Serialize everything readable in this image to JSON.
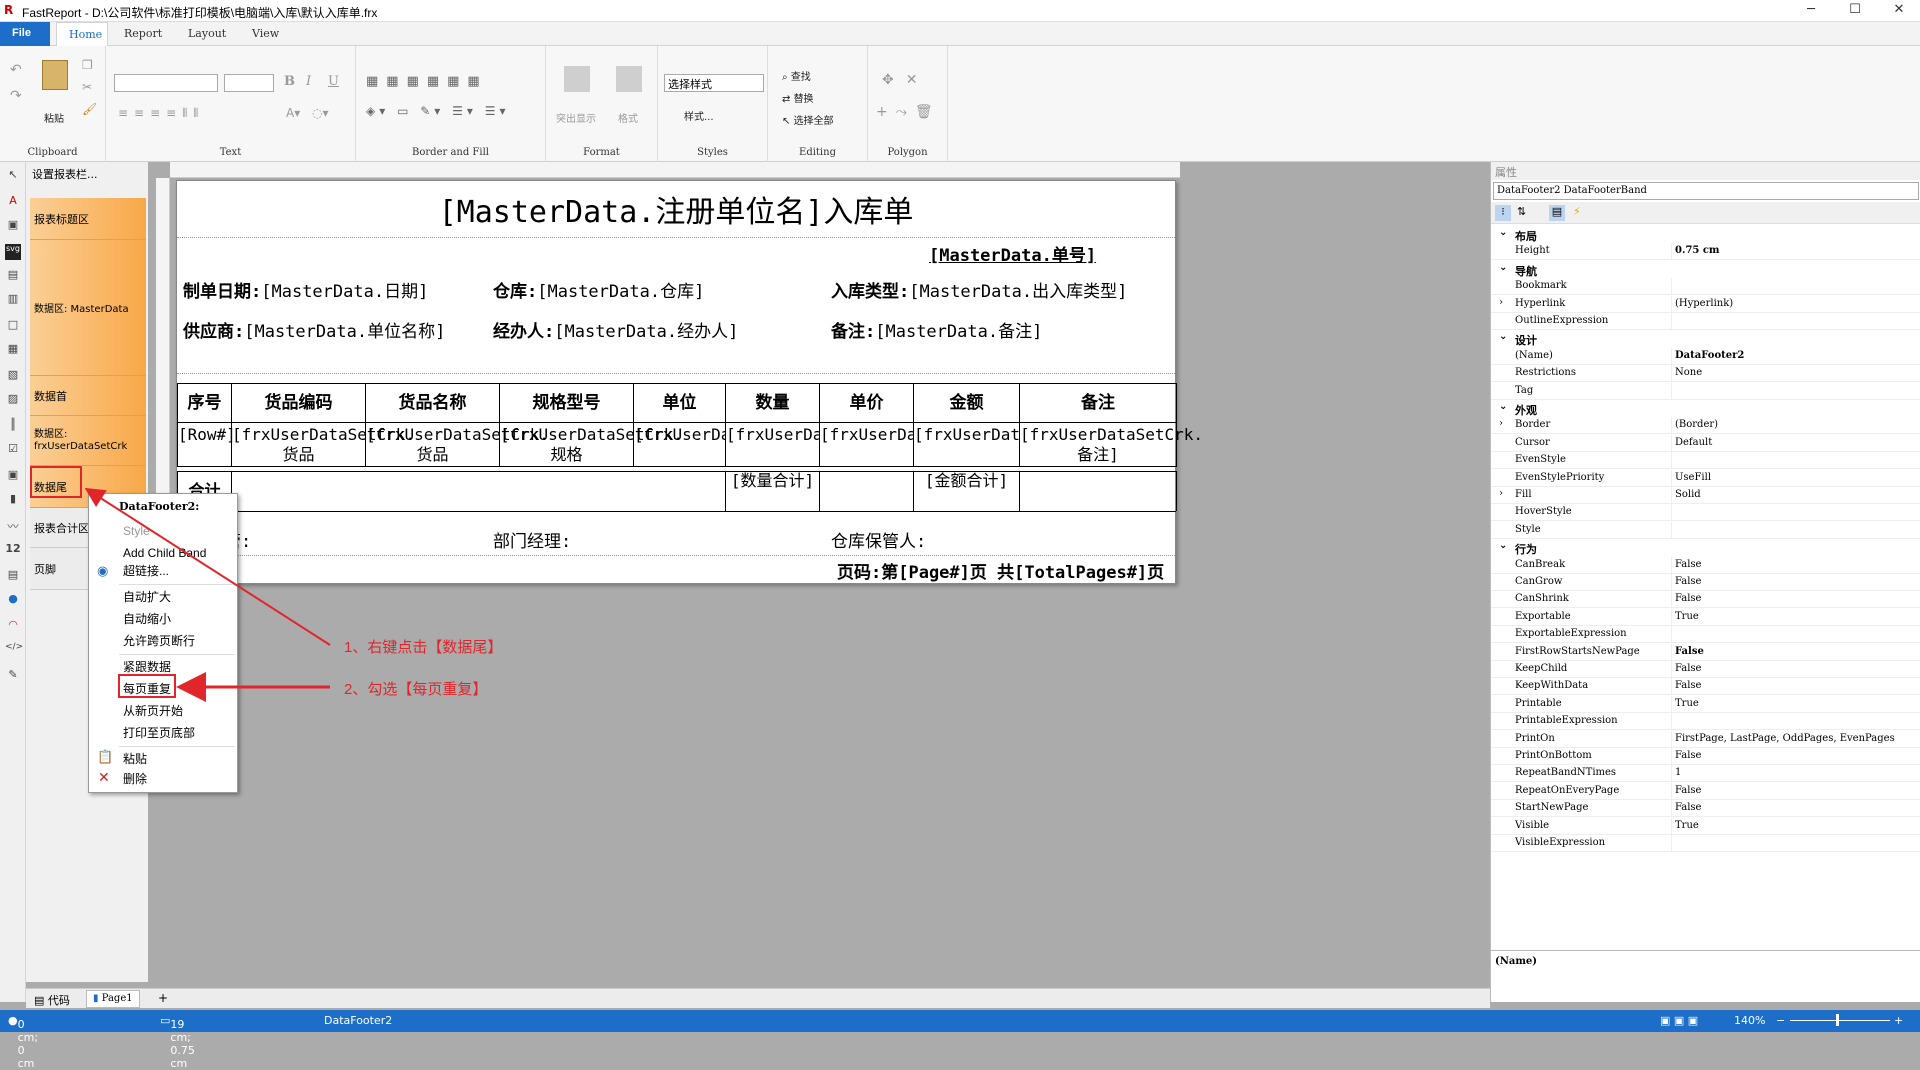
{
  "window": {
    "title": "FastReport - D:\\公司软件\\标准打印模板\\电脑端\\入库\\默认入库单.frx",
    "minimize": "─",
    "maximize": "☐",
    "close": "✕"
  },
  "tabs": [
    {
      "label": "File"
    },
    {
      "label": "Home"
    },
    {
      "label": "Report"
    },
    {
      "label": "Layout"
    },
    {
      "label": "View"
    }
  ],
  "ribbon": {
    "clipboard": {
      "label": "Clipboard",
      "paste": "粘贴"
    },
    "text": {
      "label": "Text",
      "bold": "B",
      "italic": "I",
      "underline": "U"
    },
    "border": {
      "label": "Border and Fill"
    },
    "format": {
      "label": "Format",
      "highlight": "突出显示",
      "format_btn": "格式"
    },
    "styles": {
      "label": "Styles",
      "select": "选择样式",
      "style_btn": "样式..."
    },
    "editing": {
      "label": "Editing",
      "find": "查找",
      "replace": "替换",
      "select_all": "选择全部"
    },
    "polygon": {
      "label": "Polygon"
    }
  },
  "bands": {
    "top_setting": "设置报表栏...",
    "items": [
      {
        "label": "报表标题区"
      },
      {
        "label": "数据区: MasterData"
      },
      {
        "label": "数据首"
      },
      {
        "label": "数据区:\nfrxUserDataSetCrk"
      },
      {
        "label": "数据尾"
      },
      {
        "label": "报表合计区"
      },
      {
        "label": "页脚"
      }
    ]
  },
  "report": {
    "title": "[MasterData.注册单位名]入库单",
    "bill_no": "[MasterData.单号]",
    "fields": [
      {
        "label": "制单日期:",
        "value": "[MasterData.日期]"
      },
      {
        "label": "仓库:",
        "value": "[MasterData.仓库]"
      },
      {
        "label": "入库类型:",
        "value": "[MasterData.出入库类型]"
      },
      {
        "label": "供应商:",
        "value": "[MasterData.单位名称]"
      },
      {
        "label": "经办人:",
        "value": "[MasterData.经办人]"
      },
      {
        "label": "备注:",
        "value": "[MasterData.备注]"
      }
    ],
    "headers": [
      "序号",
      "货品编码",
      "货品名称",
      "规格型号",
      "单位",
      "数量",
      "单价",
      "金额",
      "备注"
    ],
    "data_row": [
      "[Row#]",
      "[frxUserDataSetCrk.货品",
      "[frxUserDataSetCrk.货品",
      "[frxUserDataSetCrk.规格",
      "[frxUserDataSetC",
      "[frxUserDataSetC",
      "[frxUserDataSetC",
      "[frxUserDataSetCrk",
      "[frxUserDataSetCrk.备注]"
    ],
    "sum_label": "合计",
    "sum_qty": "[数量合计]",
    "sum_amount": "[金额合计]",
    "footer_manager": "主管:",
    "footer_dept": "部门经理:",
    "footer_keeper": "仓库保管人:",
    "page_no": "页码:第[Page#]页 共[TotalPages#]页"
  },
  "context_menu": {
    "header": "DataFooter2:",
    "items": [
      {
        "label": "Style",
        "disabled": true
      },
      {
        "label": "Add Child Band"
      },
      {
        "label": "超链接..."
      },
      {
        "label": "自动扩大"
      },
      {
        "label": "自动缩小"
      },
      {
        "label": "允许跨页断行"
      },
      {
        "label": "紧跟数据"
      },
      {
        "label": "每页重复"
      },
      {
        "label": "从新页开始"
      },
      {
        "label": "打印至页底部"
      },
      {
        "label": "粘贴"
      },
      {
        "label": "删除"
      }
    ]
  },
  "annotations": {
    "step1": "1、右键点击【数据尾】",
    "step2": "2、勾选【每页重复】"
  },
  "properties": {
    "header": "属性",
    "object": "DataFooter2 DataFooterBand",
    "rows": [
      {
        "cat": "布局"
      },
      {
        "name": "Height",
        "value": "0.75 cm",
        "bold": true
      },
      {
        "cat": "导航"
      },
      {
        "name": "Bookmark",
        "value": ""
      },
      {
        "name": "Hyperlink",
        "value": "(Hyperlink)",
        "exp": true
      },
      {
        "name": "OutlineExpression",
        "value": ""
      },
      {
        "cat": "设计"
      },
      {
        "name": "(Name)",
        "value": "DataFooter2",
        "bold": true
      },
      {
        "name": "Restrictions",
        "value": "None"
      },
      {
        "name": "Tag",
        "value": ""
      },
      {
        "cat": "外观"
      },
      {
        "name": "Border",
        "value": "(Border)",
        "exp": true
      },
      {
        "name": "Cursor",
        "value": "Default"
      },
      {
        "name": "EvenStyle",
        "value": ""
      },
      {
        "name": "EvenStylePriority",
        "value": "UseFill"
      },
      {
        "name": "Fill",
        "value": "Solid",
        "exp": true
      },
      {
        "name": "HoverStyle",
        "value": ""
      },
      {
        "name": "Style",
        "value": ""
      },
      {
        "cat": "行为"
      },
      {
        "name": "CanBreak",
        "value": "False"
      },
      {
        "name": "CanGrow",
        "value": "False"
      },
      {
        "name": "CanShrink",
        "value": "False"
      },
      {
        "name": "Exportable",
        "value": "True"
      },
      {
        "name": "ExportableExpression",
        "value": ""
      },
      {
        "name": "FirstRowStartsNewPage",
        "value": "False",
        "bold": true
      },
      {
        "name": "KeepChild",
        "value": "False"
      },
      {
        "name": "KeepWithData",
        "value": "False"
      },
      {
        "name": "Printable",
        "value": "True"
      },
      {
        "name": "PrintableExpression",
        "value": ""
      },
      {
        "name": "PrintOn",
        "value": "FirstPage, LastPage, OddPages, EvenPages"
      },
      {
        "name": "PrintOnBottom",
        "value": "False"
      },
      {
        "name": "RepeatBandNTimes",
        "value": "1"
      },
      {
        "name": "RepeatOnEveryPage",
        "value": "False"
      },
      {
        "name": "StartNewPage",
        "value": "False"
      },
      {
        "name": "Visible",
        "value": "True"
      },
      {
        "name": "VisibleExpression",
        "value": ""
      }
    ],
    "desc": "(Name)"
  },
  "bottom_tabs": {
    "code": "代码",
    "page": "Page1",
    "add": "+"
  },
  "status": {
    "pos": "0 cm; 0 cm",
    "size": "19 cm; 0.75 cm",
    "object": "DataFooter2",
    "zoom": "140%"
  }
}
